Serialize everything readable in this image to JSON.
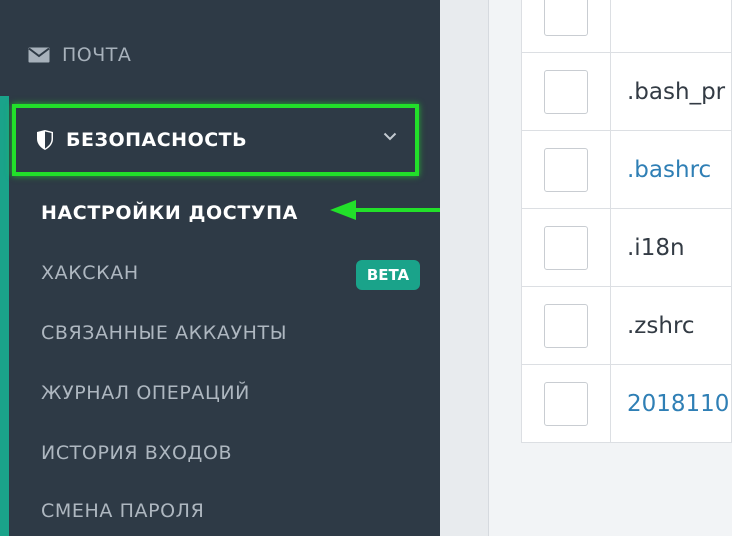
{
  "sidebar": {
    "mail_label": "ПОЧТА",
    "security_label": "БЕЗОПАСНОСТЬ",
    "items": [
      {
        "label": "НАСТРОЙКИ ДОСТУПА",
        "active": true
      },
      {
        "label": "ХАКСКАН",
        "badge": "BETA"
      },
      {
        "label": "СВЯЗАННЫЕ АККАУНТЫ"
      },
      {
        "label": "ЖУРНАЛ ОПЕРАЦИЙ"
      },
      {
        "label": "ИСТОРИЯ ВХОДОВ"
      },
      {
        "label": "СМЕНА ПАРОЛЯ"
      }
    ]
  },
  "files": [
    {
      "name": "",
      "link": false
    },
    {
      "name": ".bash_pr",
      "link": false
    },
    {
      "name": ".bashrc",
      "link": true
    },
    {
      "name": ".i18n",
      "link": false
    },
    {
      "name": ".zshrc",
      "link": false
    },
    {
      "name": "2018110",
      "link": true
    }
  ],
  "colors": {
    "sidebar_bg": "#2e3a46",
    "accent": "#1aa38a",
    "highlight": "#22e02a",
    "link": "#2f7fb5"
  },
  "icons": {
    "mail": "mail-icon",
    "shield": "shield-icon",
    "chevron": "chevron-down-icon",
    "annotation": "arrow-left-icon"
  }
}
